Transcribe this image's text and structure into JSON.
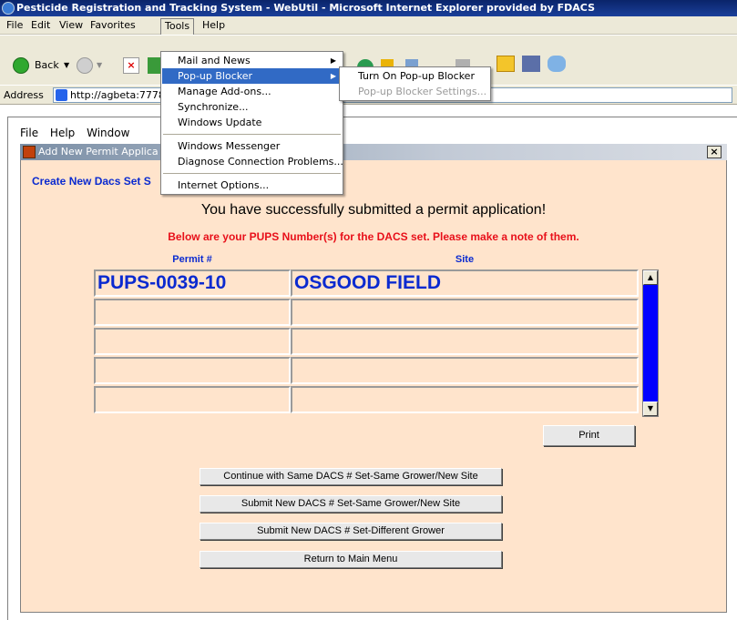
{
  "window": {
    "title": "Pesticide Registration and Tracking System - WebUtil - Microsoft Internet Explorer provided by FDACS"
  },
  "menubar": {
    "items": [
      "File",
      "Edit",
      "View",
      "Favorites",
      "Tools",
      "Help"
    ]
  },
  "toolbar": {
    "back_label": "Back"
  },
  "address": {
    "label": "Address",
    "value": "http://agbeta:7778,"
  },
  "tools_menu": {
    "items": [
      "Mail and News",
      "Pop-up Blocker",
      "Manage Add-ons...",
      "Synchronize...",
      "Windows Update",
      "Windows Messenger",
      "Diagnose Connection Problems...",
      "Internet Options..."
    ],
    "popup_submenu": [
      "Turn On Pop-up Blocker",
      "Pop-up Blocker Settings..."
    ]
  },
  "app_menu": {
    "items": [
      "File",
      "Help",
      "Window"
    ]
  },
  "child_window": {
    "title": "Add New Permit Applica"
  },
  "form": {
    "section_title": "Create New Dacs Set S",
    "success_message": "You have successfully submitted a permit application!",
    "note": "Below are your PUPS Number(s) for the DACS set. Please make a note of them.",
    "columns": {
      "permit": "Permit #",
      "site": "Site"
    },
    "rows": [
      {
        "permit": "PUPS-0039-10",
        "site": "OSGOOD FIELD"
      },
      {
        "permit": "",
        "site": ""
      },
      {
        "permit": "",
        "site": ""
      },
      {
        "permit": "",
        "site": ""
      },
      {
        "permit": "",
        "site": ""
      }
    ],
    "buttons": {
      "print": "Print",
      "continue_same": "Continue with Same DACS # Set-Same Grower/New Site",
      "submit_new_same_grower": "Submit New DACS # Set-Same Grower/New Site",
      "submit_new_diff_grower": "Submit New DACS # Set-Different Grower",
      "return_main": "Return to Main Menu"
    }
  },
  "colors": {
    "accent_blue": "#0a2ad0",
    "alert_red": "#e8101a",
    "form_bg": "#ffe4cc",
    "scroll_thumb": "#0000ff"
  }
}
